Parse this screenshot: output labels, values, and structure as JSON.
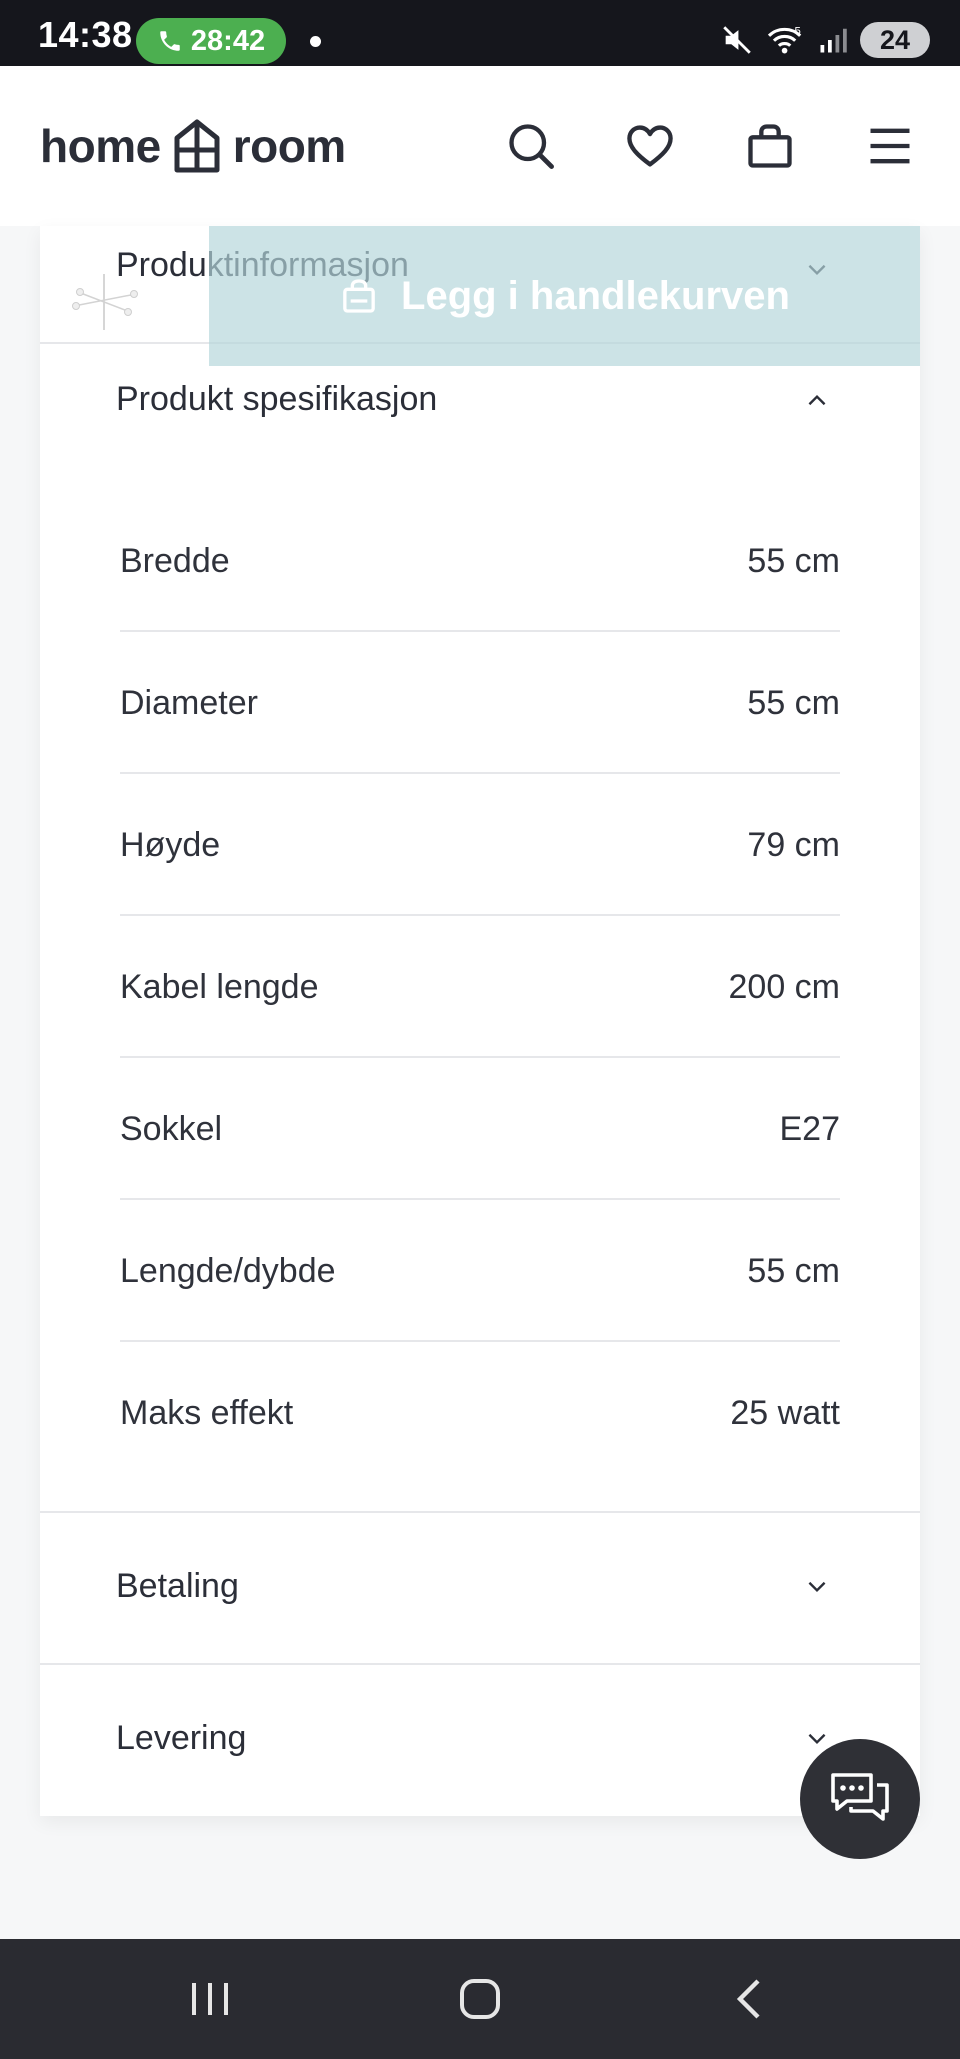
{
  "status_bar": {
    "time": "14:38",
    "call_duration": "28:42",
    "battery": "24",
    "icons": [
      "phone-icon",
      "mute-icon",
      "wifi-icon",
      "signal-icon",
      "battery-icon"
    ]
  },
  "header": {
    "logo_left": "home",
    "logo_right": "room",
    "icons": [
      "search-icon",
      "heart-icon",
      "bag-icon",
      "menu-icon"
    ]
  },
  "sticky_bar": {
    "add_to_cart_label": "Legg i handlekurven",
    "background": "#b4d6da"
  },
  "sections": {
    "product_info": {
      "title": "Produktinformasjon",
      "expanded": false
    },
    "product_spec": {
      "title": "Produkt spesifikasjon",
      "expanded": true,
      "rows": [
        {
          "label": "Bredde",
          "value": "55 cm"
        },
        {
          "label": "Diameter",
          "value": "55 cm"
        },
        {
          "label": "Høyde",
          "value": "79 cm"
        },
        {
          "label": "Kabel lengde",
          "value": "200 cm"
        },
        {
          "label": "Sokkel",
          "value": "E27"
        },
        {
          "label": "Lengde/dybde",
          "value": "55 cm"
        },
        {
          "label": "Maks effekt",
          "value": "25 watt"
        }
      ]
    },
    "payment": {
      "title": "Betaling",
      "expanded": false
    },
    "delivery": {
      "title": "Levering",
      "expanded": false
    }
  },
  "chat": {
    "icon": "chat-icon"
  },
  "nav": {
    "icons": [
      "recents-icon",
      "home-icon",
      "back-icon"
    ]
  }
}
